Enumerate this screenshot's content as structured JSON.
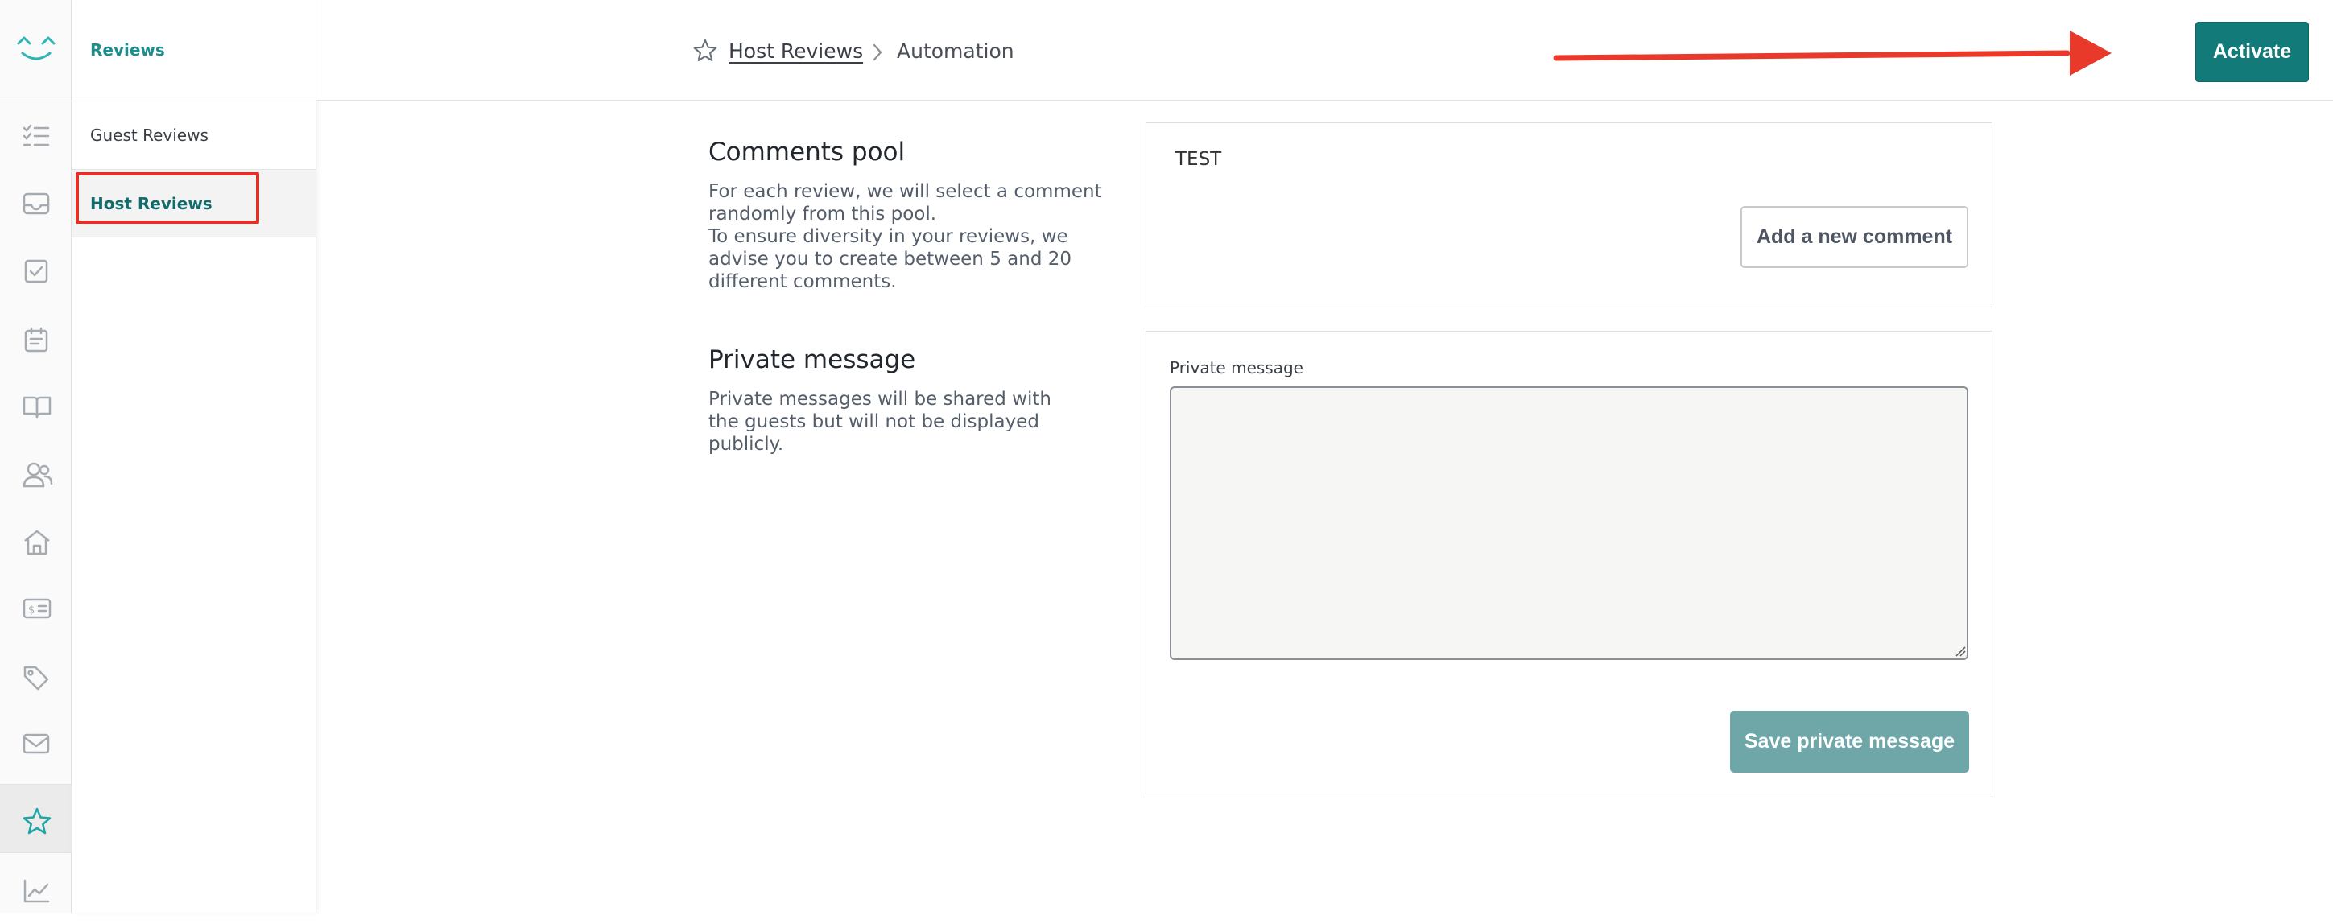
{
  "sidebar": {
    "section_title": "Reviews",
    "items": [
      {
        "label": "Guest Reviews"
      },
      {
        "label": "Host Reviews"
      }
    ]
  },
  "rail_icons": [
    "checklist-icon",
    "inbox-icon",
    "checkbox-icon",
    "calendar-icon",
    "book-icon",
    "users-icon",
    "home-icon",
    "billing-icon",
    "tag-icon",
    "mail-icon",
    "star-icon",
    "chart-icon"
  ],
  "header": {
    "breadcrumb": {
      "link": "Host Reviews",
      "current": "Automation"
    },
    "activate_label": "Activate"
  },
  "comments_pool": {
    "title": "Comments pool",
    "description_line1": "For each review, we will select a comment randomly from this pool.",
    "description_line2": "To ensure diversity in your reviews, we advise you to create between 5 and 20 different comments.",
    "comments": [
      "TEST"
    ],
    "add_label": "Add a new comment"
  },
  "private_message": {
    "title": "Private message",
    "description": "Private messages will be shared with the guests but will not be displayed publicly.",
    "field_label": "Private message",
    "value": "",
    "save_label": "Save private message"
  },
  "colors": {
    "accent": "#137a7a",
    "accent_light": "#1e8d8d",
    "save_disabled": "#6fa6a8",
    "annotation_red": "#e0312a"
  }
}
